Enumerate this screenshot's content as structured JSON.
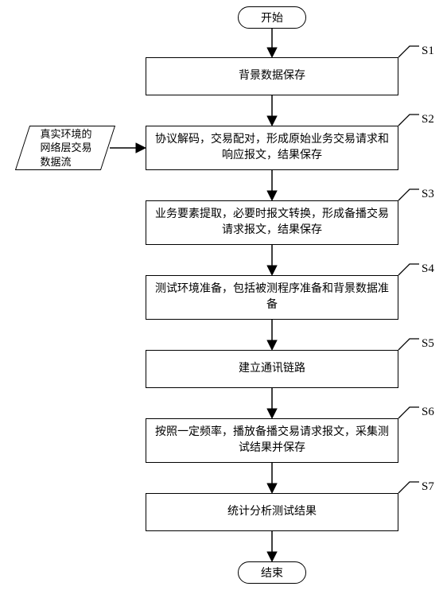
{
  "terminators": {
    "start": "开始",
    "end": "结束"
  },
  "input": {
    "data_stream": "真实环境的\n网络层交易\n数据流"
  },
  "steps": {
    "s1": {
      "label": "S1",
      "text": "背景数据保存"
    },
    "s2": {
      "label": "S2",
      "text": "协议解码，交易配对，形成原始业务交易请求和响应报文，结果保存"
    },
    "s3": {
      "label": "S3",
      "text": "业务要素提取，必要时报文转换，形成备播交易请求报文，结果保存"
    },
    "s4": {
      "label": "S4",
      "text": "测试环境准备，包括被测程序准备和背景数据准备"
    },
    "s5": {
      "label": "S5",
      "text": "建立通讯链路"
    },
    "s6": {
      "label": "S6",
      "text": "按照一定频率，播放备播交易请求报文，采集测试结果并保存"
    },
    "s7": {
      "label": "S7",
      "text": "统计分析测试结果"
    }
  }
}
